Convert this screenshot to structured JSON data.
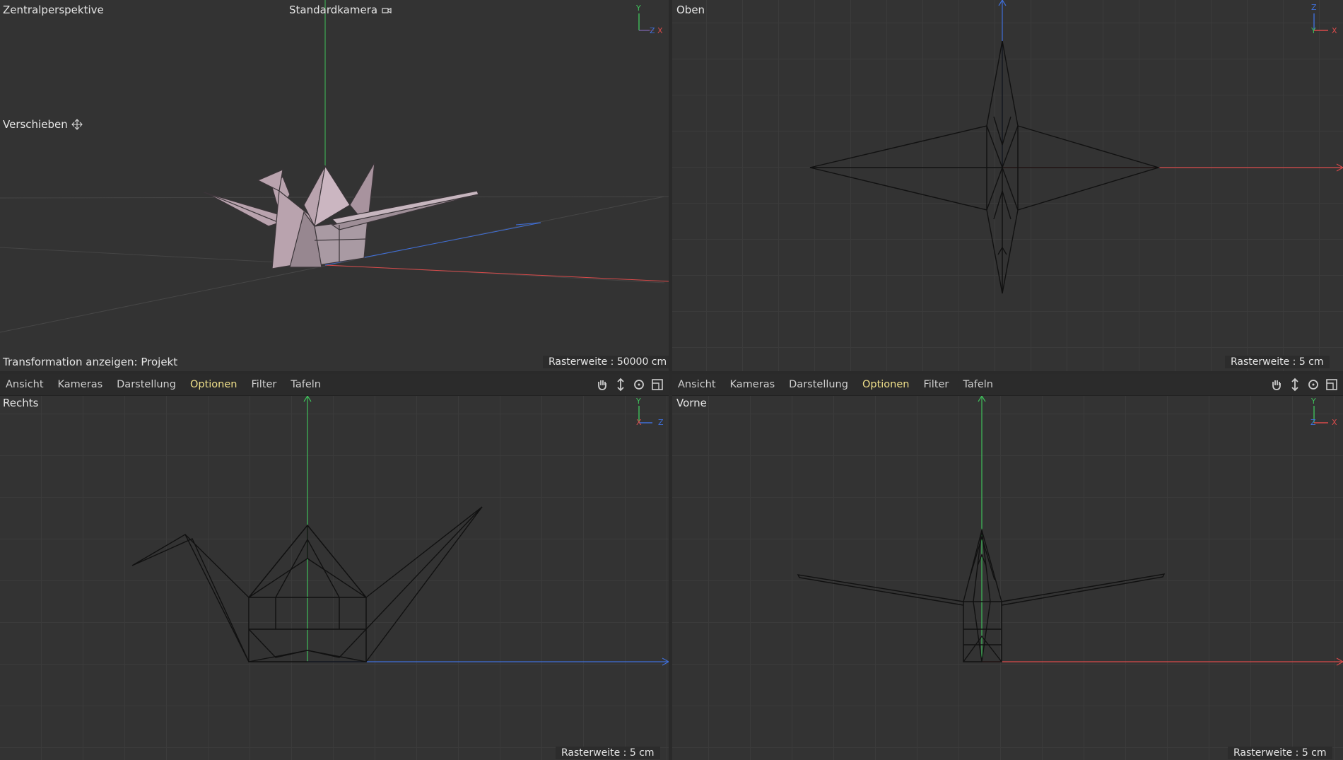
{
  "viewports": {
    "perspective": {
      "title": "Zentralperspektive",
      "camera": "Standardkamera",
      "tool": "Verschieben",
      "transform": "Transformation anzeigen: Projekt",
      "raster": "Rasterweite : 50000 cm"
    },
    "top": {
      "title": "Oben",
      "raster": "Rasterweite : 5 cm"
    },
    "right": {
      "title": "Rechts",
      "raster": "Rasterweite : 5 cm"
    },
    "front": {
      "title": "Vorne",
      "raster": "Rasterweite : 5 cm"
    }
  },
  "menus": [
    "Ansicht",
    "Kameras",
    "Darstellung",
    "Optionen",
    "Filter",
    "Tafeln"
  ],
  "axes": {
    "x": "X",
    "y": "Y",
    "z": "Z"
  },
  "colors": {
    "x_axis": "#d94a4a",
    "y_axis": "#3fbf5a",
    "z_axis": "#3f6fd9",
    "active_menu": "#f0e08a"
  },
  "icons": [
    "hand-icon",
    "move-icon",
    "rotate-icon",
    "maximize-icon",
    "camera-icon",
    "move-cross-icon"
  ]
}
